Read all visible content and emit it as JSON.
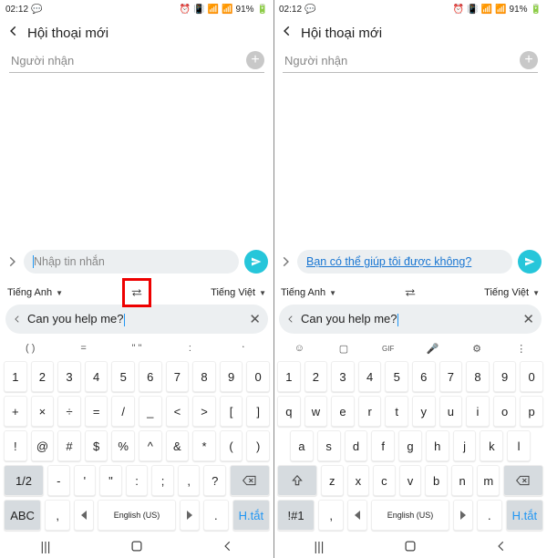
{
  "status": {
    "time": "02:12",
    "battery": "91%"
  },
  "header": {
    "title": "Hội thoại mới"
  },
  "recipient": {
    "placeholder": "Người nhận"
  },
  "message": {
    "placeholder": "Nhập tin nhắn",
    "translated": "Bạn có thể giúp tôi được không?"
  },
  "lang": {
    "src": "Tiếng Anh",
    "dst": "Tiếng Việt"
  },
  "translate_input": "Can you help me?",
  "kb1": {
    "toolrow": [
      "( )",
      "=",
      "\"  \"",
      ":",
      "᛫"
    ],
    "r1": [
      "1",
      "2",
      "3",
      "4",
      "5",
      "6",
      "7",
      "8",
      "9",
      "0"
    ],
    "r2": [
      "+",
      "×",
      "÷",
      "=",
      "/",
      "_",
      "<",
      ">",
      "[",
      "]"
    ],
    "r3": [
      "!",
      "@",
      "#",
      "$",
      "%",
      "^",
      "&",
      "*",
      "(",
      ")"
    ],
    "half": "1/2",
    "r4": [
      "-",
      "'",
      "\"",
      ":",
      ";",
      ",",
      "?"
    ],
    "abc": "ABC",
    "comma": ",",
    "space": "English (US)",
    "dot": ".",
    "shortcut": "H.tắt"
  },
  "kb2": {
    "r1": [
      "1",
      "2",
      "3",
      "4",
      "5",
      "6",
      "7",
      "8",
      "9",
      "0"
    ],
    "r2": [
      "q",
      "w",
      "e",
      "r",
      "t",
      "y",
      "u",
      "i",
      "o",
      "p"
    ],
    "r3": [
      "a",
      "s",
      "d",
      "f",
      "g",
      "h",
      "j",
      "k",
      "l"
    ],
    "r4": [
      "z",
      "x",
      "c",
      "v",
      "b",
      "n",
      "m"
    ],
    "alt": "!#1",
    "comma": ",",
    "space": "English (US)",
    "dot": ".",
    "shortcut": "H.tắt"
  },
  "icons": {
    "clock": "⏰",
    "vibe": "📳",
    "wifi": "📶",
    "sig": "📶",
    "bat": "🔋"
  }
}
